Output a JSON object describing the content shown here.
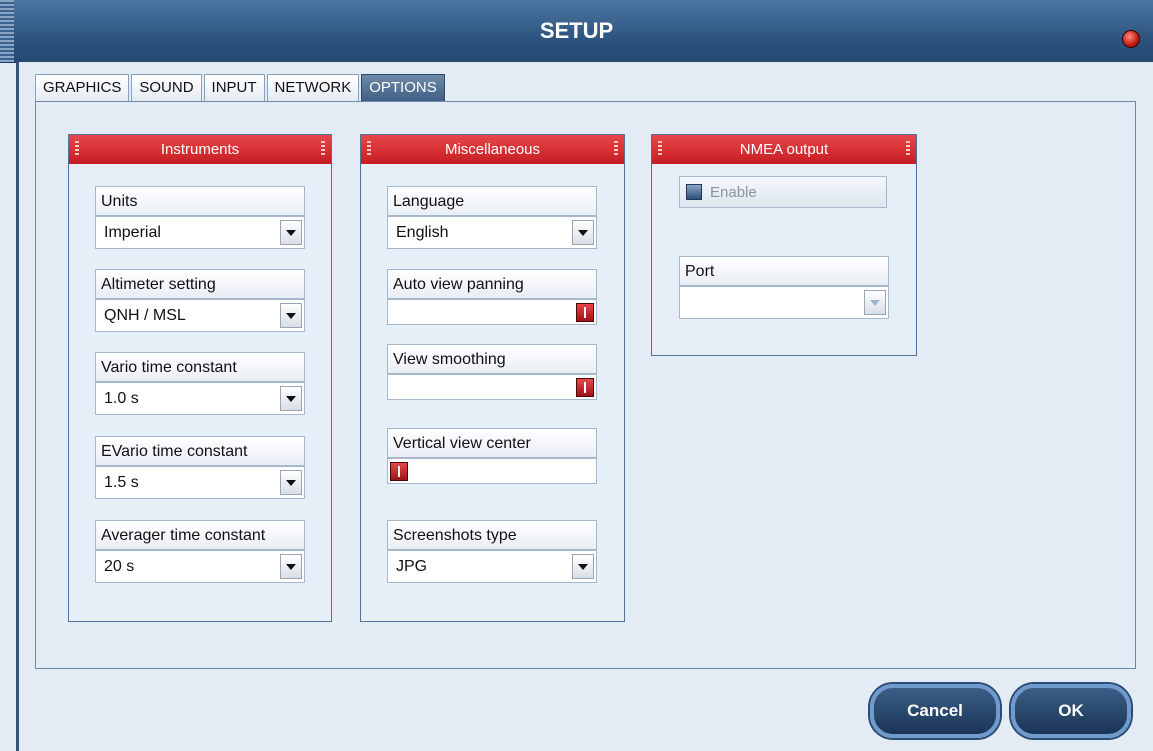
{
  "window": {
    "title": "SETUP"
  },
  "tabs": [
    {
      "label": "GRAPHICS",
      "active": false
    },
    {
      "label": "SOUND",
      "active": false
    },
    {
      "label": "INPUT",
      "active": false
    },
    {
      "label": "NETWORK",
      "active": false
    },
    {
      "label": "OPTIONS",
      "active": true
    }
  ],
  "instruments": {
    "title": "Instruments",
    "units": {
      "label": "Units",
      "value": "Imperial"
    },
    "altimeter": {
      "label": "Altimeter setting",
      "value": "QNH / MSL"
    },
    "vario": {
      "label": "Vario time constant",
      "value": "1.0 s"
    },
    "evario": {
      "label": "EVario time constant",
      "value": "1.5 s"
    },
    "averager": {
      "label": "Averager time constant",
      "value": "20 s"
    }
  },
  "misc": {
    "title": "Miscellaneous",
    "language": {
      "label": "Language",
      "value": "English"
    },
    "auto_pan": {
      "label": "Auto view panning",
      "level": 1.0
    },
    "smoothing": {
      "label": "View smoothing",
      "level": 1.0
    },
    "vertical_center": {
      "label": "Vertical view center",
      "level": 0.0
    },
    "screenshots": {
      "label": "Screenshots type",
      "value": "JPG"
    }
  },
  "nmea": {
    "title": "NMEA output",
    "enable_label": "Enable",
    "port": {
      "label": "Port",
      "value": ""
    }
  },
  "buttons": {
    "cancel": "Cancel",
    "ok": "OK"
  },
  "colors": {
    "panel_header": "#d9292d",
    "title_bar": "#2d5580",
    "active_tab": "#4f6d90"
  }
}
